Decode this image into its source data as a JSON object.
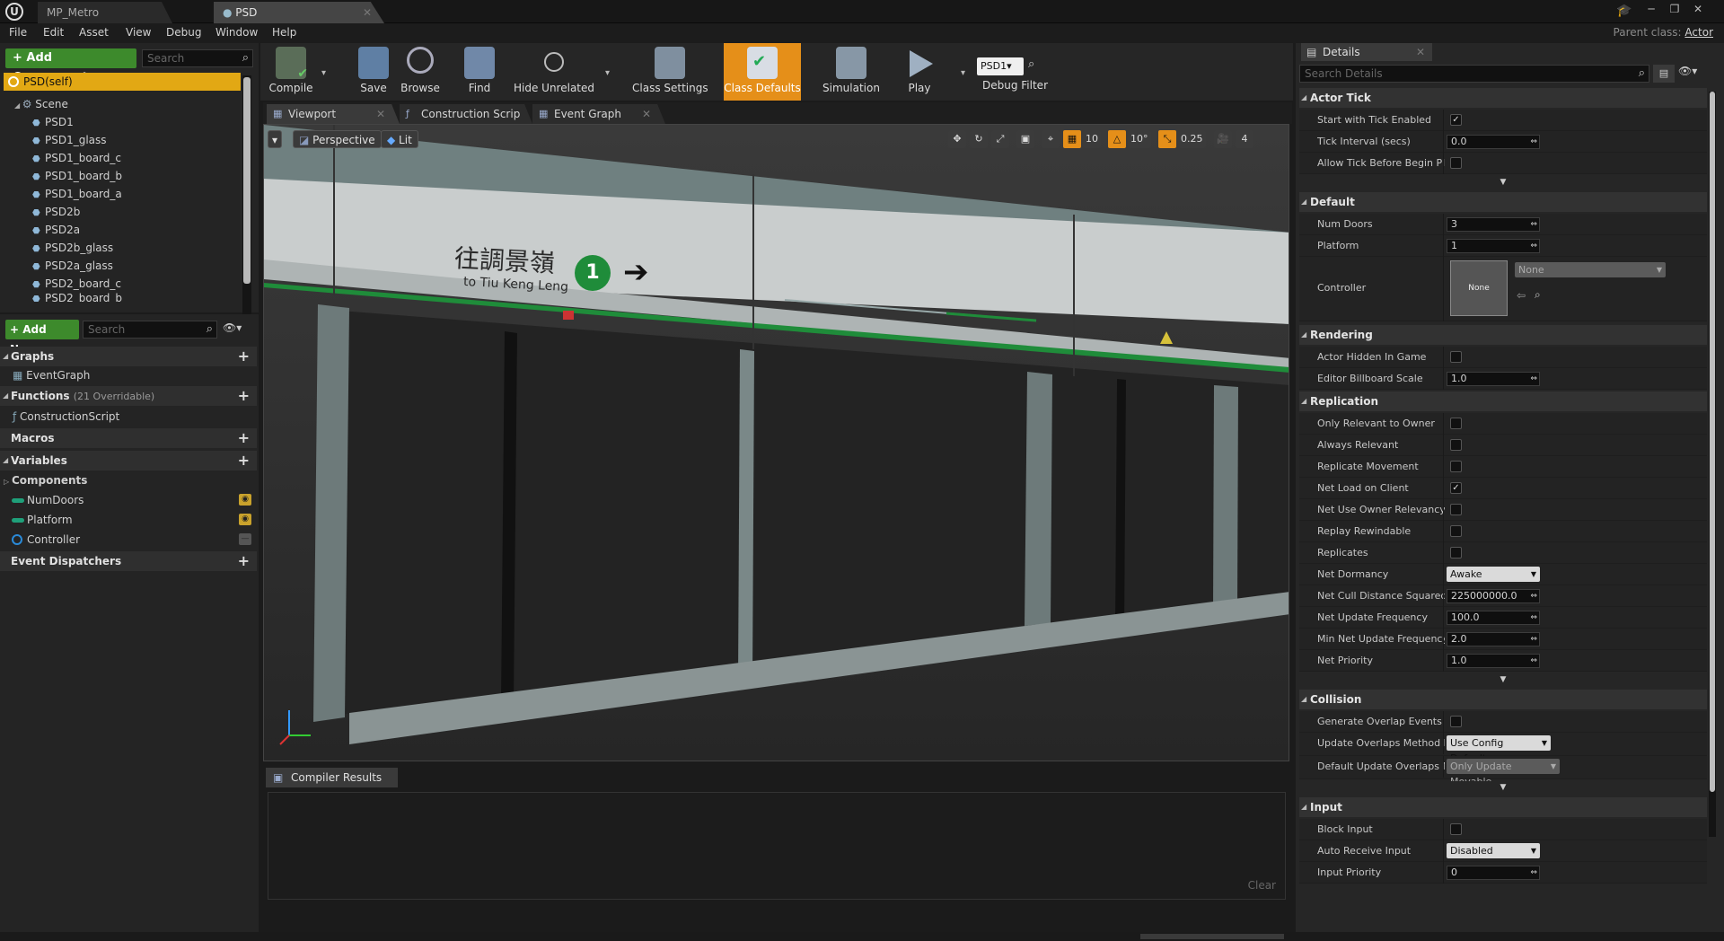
{
  "titlebar": {
    "tabs": [
      {
        "label": "MP_Metro"
      },
      {
        "label": "PSD"
      }
    ],
    "window_controls": [
      "─",
      "❐",
      "✕"
    ]
  },
  "menu": {
    "items": [
      "File",
      "Edit",
      "Asset",
      "View",
      "Debug",
      "Window",
      "Help"
    ],
    "parent_class_label": "Parent class:",
    "parent_class_value": "Actor"
  },
  "components": {
    "add_button": "+ Add Component ▾",
    "search_placeholder": "Search",
    "self_label": "PSD(self)",
    "scene_label": "Scene",
    "items": [
      "PSD1",
      "PSD1_glass",
      "PSD1_board_c",
      "PSD1_board_b",
      "PSD1_board_a",
      "PSD2b",
      "PSD2a",
      "PSD2b_glass",
      "PSD2a_glass",
      "PSD2_board_c",
      "PSD2_board_b"
    ]
  },
  "mybp": {
    "add_new": "+ Add New ▾",
    "search_placeholder": "Search",
    "graphs_label": "Graphs",
    "eventgraph_label": "EventGraph",
    "functions_label": "Functions",
    "functions_count": "(21 Overridable)",
    "construction_label": "ConstructionScript",
    "macros_label": "Macros",
    "variables_label": "Variables",
    "components_label": "Components",
    "variables": [
      {
        "name": "NumDoors",
        "color": "#1fa07a"
      },
      {
        "name": "Platform",
        "color": "#1fa07a"
      },
      {
        "name": "Controller",
        "color": "#2a8ad8"
      }
    ],
    "dispatchers_label": "Event Dispatchers"
  },
  "toolbar": {
    "compile": "Compile",
    "save": "Save",
    "browse": "Browse",
    "find": "Find",
    "hide_unrelated": "Hide Unrelated",
    "class_settings": "Class Settings",
    "class_defaults": "Class Defaults",
    "simulation": "Simulation",
    "play": "Play",
    "debug_object": "PSD1▾",
    "debug_filter": "Debug Filter"
  },
  "editor_tabs": [
    "Viewport",
    "Construction Scrip",
    "Event Graph"
  ],
  "viewport": {
    "perspective": "Perspective",
    "lit": "Lit",
    "grid_snap": "10",
    "rot_snap": "10°",
    "scale_snap": "0.25",
    "cam_speed": "4",
    "sign_chinese": "往調景嶺",
    "sign_english": "to Tiu Keng Leng",
    "sign_platform": "1",
    "sign_arrow": "➔"
  },
  "compiler": {
    "tab_label": "Compiler Results",
    "clear_label": "Clear"
  },
  "details": {
    "tab_label": "Details",
    "search_placeholder": "Search Details",
    "actor_tick": {
      "title": "Actor Tick",
      "start_label": "Start with Tick Enabled",
      "start_checked": "✓",
      "interval_label": "Tick Interval (secs)",
      "interval_value": "0.0",
      "allow_label": "Allow Tick Before Begin Play"
    },
    "default": {
      "title": "Default",
      "num_doors_label": "Num Doors",
      "num_doors_value": "3",
      "platform_label": "Platform",
      "platform_value": "1",
      "controller_label": "Controller",
      "controller_thumb": "None",
      "controller_combo": "None"
    },
    "rendering": {
      "title": "Rendering",
      "hidden_label": "Actor Hidden In Game",
      "billboard_label": "Editor Billboard Scale",
      "billboard_value": "1.0"
    },
    "replication": {
      "title": "Replication",
      "only_relevant_label": "Only Relevant to Owner",
      "always_relevant_label": "Always Relevant",
      "replicate_movement_label": "Replicate Movement",
      "net_load_label": "Net Load on Client",
      "net_load_checked": "✓",
      "net_use_owner_label": "Net Use Owner Relevancy",
      "replay_label": "Replay Rewindable",
      "replicates_label": "Replicates",
      "dormancy_label": "Net Dormancy",
      "dormancy_value": "Awake",
      "cull_label": "Net Cull Distance Squared",
      "cull_value": "225000000.0",
      "update_freq_label": "Net Update Frequency",
      "update_freq_value": "100.0",
      "min_update_label": "Min Net Update Frequency",
      "min_update_value": "2.0",
      "priority_label": "Net Priority",
      "priority_value": "1.0"
    },
    "collision": {
      "title": "Collision",
      "overlap_label": "Generate Overlap Events Dur",
      "update_method_label": "Update Overlaps Method Dur",
      "update_method_value": "Use Config Default",
      "default_update_label": "Default Update Overlaps Met",
      "default_update_value": "Only Update Movable"
    },
    "input": {
      "title": "Input",
      "block_label": "Block Input",
      "auto_label": "Auto Receive Input",
      "auto_value": "Disabled",
      "priority_label": "Input Priority",
      "priority_value": "0"
    }
  },
  "colors": {
    "accent_orange": "#e58f19",
    "add_green": "#3d8a2c",
    "self_highlight": "#e2a814",
    "stripe_green": "#1f8c3a"
  }
}
